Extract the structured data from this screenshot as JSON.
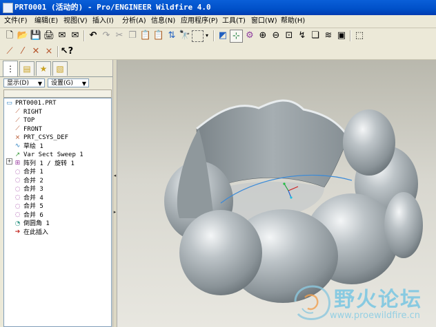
{
  "window": {
    "title": "PRT0001 (活动的) - Pro/ENGINEER Wildfire 4.0"
  },
  "menu": [
    "文件(F)",
    "编辑(E)",
    "视图(V)",
    "插入(I)",
    "分析(A)",
    "信息(N)",
    "应用程序(P)",
    "工具(T)",
    "窗口(W)",
    "帮助(H)"
  ],
  "toolbar1": [
    "new-icon",
    "open-icon",
    "save-icon",
    "print-icon",
    "email-icon",
    "envelope-icon",
    "undo-icon",
    "redo-icon",
    "cut-icon",
    "copy-icon",
    "paste-icon",
    "paste-special-icon",
    "regenerate-icon",
    "find-icon",
    "select-box-icon",
    "dropdown-arrow-icon",
    "datum-display-icon",
    "spin-center-icon",
    "orient-icon",
    "zoom-in-icon",
    "zoom-out-icon",
    "refit-icon",
    "repaint-icon",
    "layers-icon",
    "view-manager-icon",
    "saved-views-icon",
    "wireframe-icon"
  ],
  "toolbar2": [
    "datum-plane-icon",
    "datum-axis-icon",
    "datum-point-icon",
    "csys-icon",
    "whats-this-icon"
  ],
  "panel": {
    "show_label": "显示(D)",
    "settings_label": "设置(G)",
    "tabs": [
      "model-tree-tab",
      "folder-tab",
      "favorites-tab",
      "layer-tab"
    ]
  },
  "tree": [
    {
      "label": "PRT0001.PRT",
      "icon": "part-icon",
      "indent": 0,
      "color": "#2a7fbf"
    },
    {
      "label": "RIGHT",
      "icon": "datum-plane-icon",
      "indent": 1,
      "color": "#b5532a"
    },
    {
      "label": "TOP",
      "icon": "datum-plane-icon",
      "indent": 1,
      "color": "#b5532a"
    },
    {
      "label": "FRONT",
      "icon": "datum-plane-icon",
      "indent": 1,
      "color": "#b5532a"
    },
    {
      "label": "PRT_CSYS_DEF",
      "icon": "csys-icon",
      "indent": 1,
      "color": "#b5532a"
    },
    {
      "label": "草绘 1",
      "icon": "sketch-icon",
      "indent": 1,
      "color": "#2a7fbf"
    },
    {
      "label": "Var Sect Sweep 1",
      "icon": "sweep-icon",
      "indent": 1,
      "color": "#3a9a3a"
    },
    {
      "label": "阵列 1 / 旋转 1",
      "icon": "pattern-icon",
      "indent": 1,
      "color": "#9a3aa0"
    },
    {
      "label": "合并 1",
      "icon": "merge-icon",
      "indent": 1,
      "color": "#9a3aa0"
    },
    {
      "label": "合并 2",
      "icon": "merge-icon",
      "indent": 1,
      "color": "#9a3aa0"
    },
    {
      "label": "合并 3",
      "icon": "merge-icon",
      "indent": 1,
      "color": "#9a3aa0"
    },
    {
      "label": "合并 4",
      "icon": "merge-icon",
      "indent": 1,
      "color": "#9a3aa0"
    },
    {
      "label": "合并 5",
      "icon": "merge-icon",
      "indent": 1,
      "color": "#9a3aa0"
    },
    {
      "label": "合并 6",
      "icon": "merge-icon",
      "indent": 1,
      "color": "#9a3aa0"
    },
    {
      "label": "倒圆角 1",
      "icon": "round-icon",
      "indent": 1,
      "color": "#3a9a8a"
    },
    {
      "label": "在此插入",
      "icon": "insert-here-icon",
      "indent": 1,
      "color": "#c0201a"
    }
  ],
  "watermark": {
    "text": "野火论坛",
    "url": "www.proewildfire.cn"
  },
  "colors": {
    "title_bar": "#0050c8",
    "model": "#a8afb3",
    "background": "#d8d7cf",
    "watermark": "#7fc8e2"
  }
}
